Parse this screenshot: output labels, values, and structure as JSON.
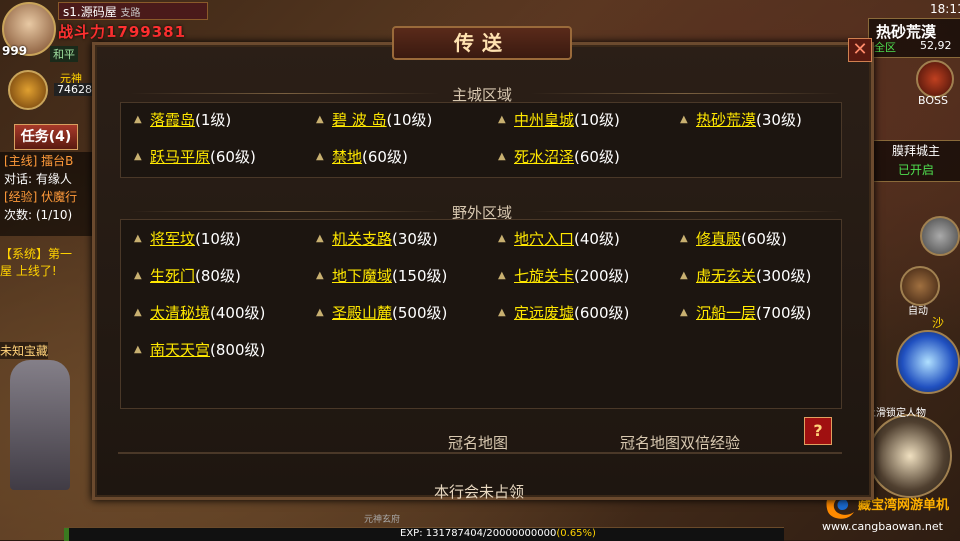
{
  "dialog": {
    "title": "传送",
    "close_glyph": "✕",
    "sections": [
      {
        "title": "主城区域",
        "destinations": [
          {
            "name": "落霞岛",
            "level": "(1级)"
          },
          {
            "name": "碧 波 岛",
            "level": "(10级)"
          },
          {
            "name": "中州皇城",
            "level": "(10级)"
          },
          {
            "name": "热砂荒漠",
            "level": "(30级)"
          },
          {
            "name": "跃马平原",
            "level": "(60级)"
          },
          {
            "name": "禁地",
            "level": "(60级)"
          },
          {
            "name": "死水沼泽",
            "level": "(60级)"
          }
        ]
      },
      {
        "title": "野外区域",
        "destinations": [
          {
            "name": "将军坟",
            "level": "(10级)"
          },
          {
            "name": "机关支路",
            "level": "(30级)"
          },
          {
            "name": "地穴入口",
            "level": "(40级)"
          },
          {
            "name": "修真殿",
            "level": "(60级)"
          },
          {
            "name": "生死门",
            "level": "(80级)"
          },
          {
            "name": "地下魔域",
            "level": "(150级)"
          },
          {
            "name": "七旋关卡",
            "level": "(200级)"
          },
          {
            "name": "虚无玄关",
            "level": "(300级)"
          },
          {
            "name": "太清秘境",
            "level": "(400级)"
          },
          {
            "name": "圣殿山麓",
            "level": "(500级)"
          },
          {
            "name": "定远废墟",
            "level": "(600级)"
          },
          {
            "name": "沉船一层",
            "level": "(700级)"
          },
          {
            "name": "南天天宫",
            "level": "(800级)"
          }
        ]
      }
    ],
    "footer": {
      "titled_map": "冠名地图",
      "titled_map_double_exp": "冠名地图双倍经验",
      "help": "?",
      "guild_status": "本行会未占领"
    }
  },
  "hud": {
    "level": "999",
    "server": "s1.源码屋",
    "server_sub": "支路",
    "combat_power": "战斗力1799381",
    "mode": "和平",
    "spirit_label": "元神",
    "spirit_value": "74628",
    "task_button": "任务(4)",
    "task_lines": [
      "[主线] 擂台B",
      "对话: 有缘人",
      "[经验] 伏魔行",
      "次数: (1/10)"
    ],
    "system_msg": [
      "【系统】第一",
      "屋 上线了!"
    ],
    "treasure": "未知宝藏"
  },
  "topright": {
    "time": "18:11",
    "map_name": "热砂荒漠",
    "zone": "全区",
    "coords": "52,92",
    "boss": "BOSS",
    "worship_title": "膜拜城主",
    "worship_status": "已开启",
    "auto": "自动",
    "sand": "沙",
    "lock_target": "上滑锁定人物"
  },
  "bottom": {
    "shrine": "元神玄府",
    "exp_text": "EXP: 131787404/20000000000",
    "exp_pct": "(0.65%)",
    "exp_fraction": 0.0065,
    "watermark_title": "藏宝湾网游单机",
    "watermark_url": "www.cangbaowan.net"
  },
  "colors": {
    "dest_name": "#ffe800",
    "dest_level": "#ffffff",
    "section_title": "#d8c8b0",
    "combat_power": "#ff3030",
    "zone_green": "#4fe04f"
  }
}
